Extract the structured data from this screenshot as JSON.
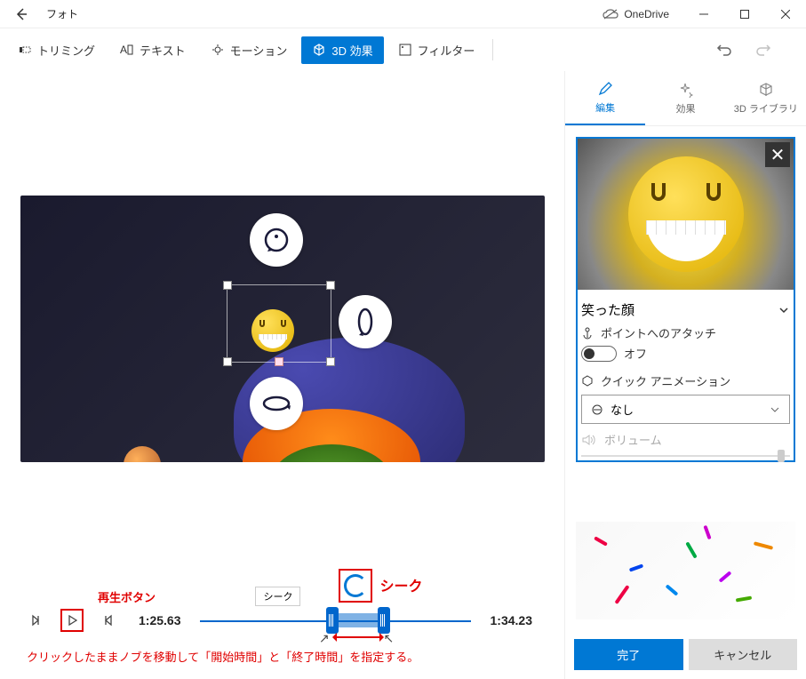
{
  "titlebar": {
    "app_title": "フォト",
    "onedrive": "OneDrive"
  },
  "toolbar": {
    "trimming": "トリミング",
    "text": "テキスト",
    "motion": "モーション",
    "effects_3d": "3D 効果",
    "filter": "フィルター"
  },
  "side_tabs": {
    "edit": "編集",
    "effects": "効果",
    "library_3d": "3D ライブラリ"
  },
  "object": {
    "name": "笑った顔",
    "attach_label": "ポイントへのアタッチ",
    "attach_state": "オフ",
    "anim_label": "クイック アニメーション",
    "anim_value": "なし",
    "volume_label": "ボリューム"
  },
  "timeline": {
    "play_label": "再生ボタン",
    "seek_tooltip": "シーク",
    "seek_label": "シーク",
    "current_time": "1:25.63",
    "end_time": "1:34.23"
  },
  "instruction": "クリックしたままノブを移動して「開始時間」と「終了時間」を指定する。",
  "footer": {
    "done": "完了",
    "cancel": "キャンセル"
  }
}
